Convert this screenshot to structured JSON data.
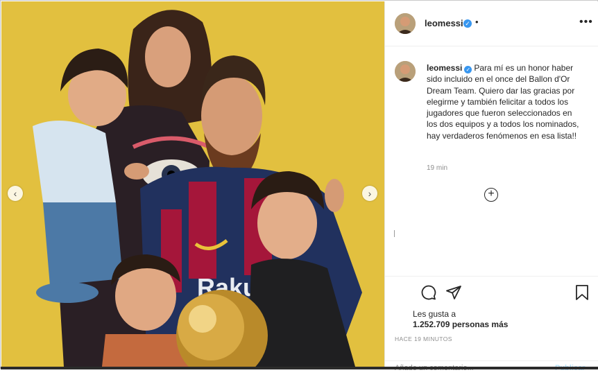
{
  "post": {
    "username": "leomessi",
    "verified_mark": "✓",
    "separator": "•",
    "more_label": "•••",
    "caption": "Para mí es un honor haber sido incluido en el once del Ballon d'Or Dream Team. Quiero dar las gracias por elegirme y también felicitar a todos los jugadores que fueron seleccionados en los dos equipos y a todos los nominados, hay verdaderos fenómenos en esa lista!!",
    "caption_time": "19 min",
    "add_label": "+",
    "likes_prefix": "Les gusta a",
    "likes_count": "1.252.709 personas más",
    "time_ago": "HACE 19 MINUTOS",
    "comment_placeholder": "Añade un comentario...",
    "publish_label": "Publicar"
  },
  "photo": {
    "prev_label": "‹",
    "next_label": "›",
    "shirt_sponsor": "Rakuten",
    "background_color": "#e2c03f"
  },
  "icons": {
    "comment": "comment-icon",
    "share": "share-icon",
    "save": "bookmark-icon"
  }
}
